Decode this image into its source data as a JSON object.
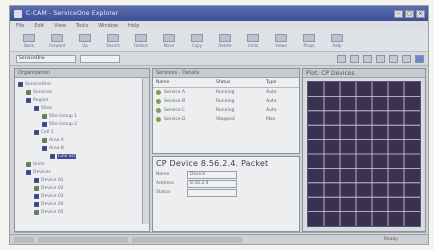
{
  "window": {
    "title": "C-CAM - ServiceOne Explorer"
  },
  "menu": [
    "File",
    "Edit",
    "View",
    "Tools",
    "Window",
    "Help"
  ],
  "toolbar": [
    {
      "label": "Back",
      "icon": "back-icon"
    },
    {
      "label": "Forward",
      "icon": "forward-icon"
    },
    {
      "label": "Up",
      "icon": "up-icon"
    },
    {
      "label": "Search",
      "icon": "search-icon"
    },
    {
      "label": "Folders",
      "icon": "folder-icon"
    },
    {
      "label": "Move",
      "icon": "move-icon"
    },
    {
      "label": "Copy",
      "icon": "copy-icon"
    },
    {
      "label": "Delete",
      "icon": "delete-icon"
    },
    {
      "label": "Undo",
      "icon": "undo-icon"
    },
    {
      "label": "Views",
      "icon": "views-icon"
    },
    {
      "label": "Props",
      "icon": "properties-icon"
    },
    {
      "label": "Help",
      "icon": "help-icon"
    }
  ],
  "address": {
    "value": "ServiceOne"
  },
  "tree": {
    "header": "Organization",
    "items": [
      {
        "label": "ServiceOne",
        "depth": 0
      },
      {
        "label": "Services",
        "depth": 1
      },
      {
        "label": "Region",
        "depth": 1
      },
      {
        "label": "Sites",
        "depth": 2
      },
      {
        "label": "Site Group 1",
        "depth": 3
      },
      {
        "label": "Site Group 2",
        "depth": 3
      },
      {
        "label": "Cell 1",
        "depth": 2
      },
      {
        "label": "Area A",
        "depth": 3
      },
      {
        "label": "Area B",
        "depth": 3
      },
      {
        "label": "Link list",
        "depth": 4,
        "selected": true
      },
      {
        "label": "Units",
        "depth": 1
      },
      {
        "label": "Devices",
        "depth": 1
      },
      {
        "label": "Device 01",
        "depth": 2
      },
      {
        "label": "Device 02",
        "depth": 2
      },
      {
        "label": "Device 03",
        "depth": 2
      },
      {
        "label": "Device 04",
        "depth": 2
      },
      {
        "label": "Device 05",
        "depth": 2
      }
    ]
  },
  "list": {
    "header": "Services - Details",
    "columns": [
      "Name",
      "Status",
      "Type"
    ],
    "rows": [
      {
        "name": "Service A",
        "status": "Running",
        "type": "Auto"
      },
      {
        "name": "Service B",
        "status": "Running",
        "type": "Auto"
      },
      {
        "name": "Service C",
        "status": "Running",
        "type": "Auto"
      },
      {
        "name": "Service D",
        "status": "Stopped",
        "type": "Man"
      }
    ]
  },
  "detail": {
    "title": "CP Device 8.56.2.4. Packet",
    "fields": [
      {
        "label": "Name",
        "value": "Device"
      },
      {
        "label": "Address",
        "value": "8.56.2.4"
      },
      {
        "label": "Status",
        "value": ""
      }
    ]
  },
  "graph": {
    "header": "Plot: CP Devices"
  },
  "status": {
    "right": "Ready"
  },
  "colors": {
    "title_bar": "#3e4f94",
    "graph_bg": "#3a3050",
    "selection": "#3e4f94"
  }
}
